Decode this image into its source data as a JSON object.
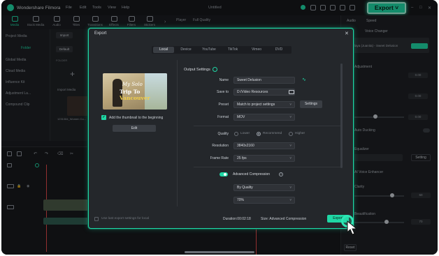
{
  "app": {
    "name": "Wondershare Filmora",
    "document": "Untitled",
    "menu": [
      "File",
      "Edit",
      "Tools",
      "View",
      "Help"
    ],
    "export_label": "Export ˅"
  },
  "toolbar": {
    "items": [
      {
        "label": "Media"
      },
      {
        "label": "Stock Media"
      },
      {
        "label": "Audio"
      },
      {
        "label": "Titles"
      },
      {
        "label": "Transitions"
      },
      {
        "label": "Effects"
      },
      {
        "label": "Filters"
      },
      {
        "label": "Stickers"
      }
    ]
  },
  "sidebar": {
    "items": [
      "Project Media",
      "Folder",
      "Global Media",
      "Cloud Media",
      "Influence Kit",
      "Adjustment La...",
      "Compound Clip"
    ]
  },
  "media": {
    "import_btn": "Import",
    "default_btn": "Default",
    "folder_label": "FOLDER",
    "import_media": "Import Media",
    "clip_name": "1231084_Women Co..."
  },
  "player": {
    "label": "Player",
    "quality": "Full Quality"
  },
  "right_panel": {
    "tab_audio": "Audio",
    "tab_speed": "Speed",
    "voice_changer": "Voice Changer",
    "preset_name": "Playa (Juanita) - Sweet Delusion",
    "adjustment": "Adjustment",
    "values": [
      "0.00",
      "0.00",
      "0.00"
    ],
    "auto_ducking": "Auto Ducking",
    "equalizer": "Equalizer",
    "default_eq": "Default",
    "eq_settings": "Setting",
    "ai_voice": "AI Voice Enhancer",
    "clarity": "Clarity",
    "clarity_value": "60",
    "beautify": "Beautification",
    "beautify_value": "70",
    "reset": "Reset"
  },
  "dialog": {
    "title": "Export",
    "tabs": [
      "Local",
      "Device",
      "YouTube",
      "TikTok",
      "Vimeo",
      "DVD"
    ],
    "active_tab": "Local",
    "thumbnail": {
      "line1": "My Solo",
      "line2a": "Trip To",
      "line2b": "Vancouver"
    },
    "add_thumbnail": "Add the thumbnail to the beginning",
    "edit_btn": "Edit",
    "output_title": "Output Settings",
    "fields": {
      "name_label": "Name",
      "name_value": "Sweet Delusion",
      "save_label": "Save to",
      "save_value": "D:/Video Resources",
      "preset_label": "Preset",
      "preset_value": "Match to project settings",
      "settings_btn": "Settings",
      "format_label": "Format",
      "format_value": "MOV",
      "quality_label": "Quality",
      "quality_opts": [
        "Lower",
        "Recommend",
        "Higher"
      ],
      "quality_selected": "Recommend",
      "resolution_label": "Resolution",
      "resolution_value": "3840x2160",
      "framerate_label": "Frame Rate",
      "framerate_value": "25 fps",
      "adv_label": "Advanced Compression",
      "adv_mode": "By Quality",
      "adv_percent": "70%"
    },
    "footer": {
      "use_last": "Use last export settings for local",
      "duration": "Duration:00:02:18",
      "size": "Size: Advanced Compression",
      "export_btn": "Export"
    }
  },
  "colors": {
    "accent": "#1fd7a5",
    "background": "#1b1d21",
    "dialog": "#24272b"
  }
}
